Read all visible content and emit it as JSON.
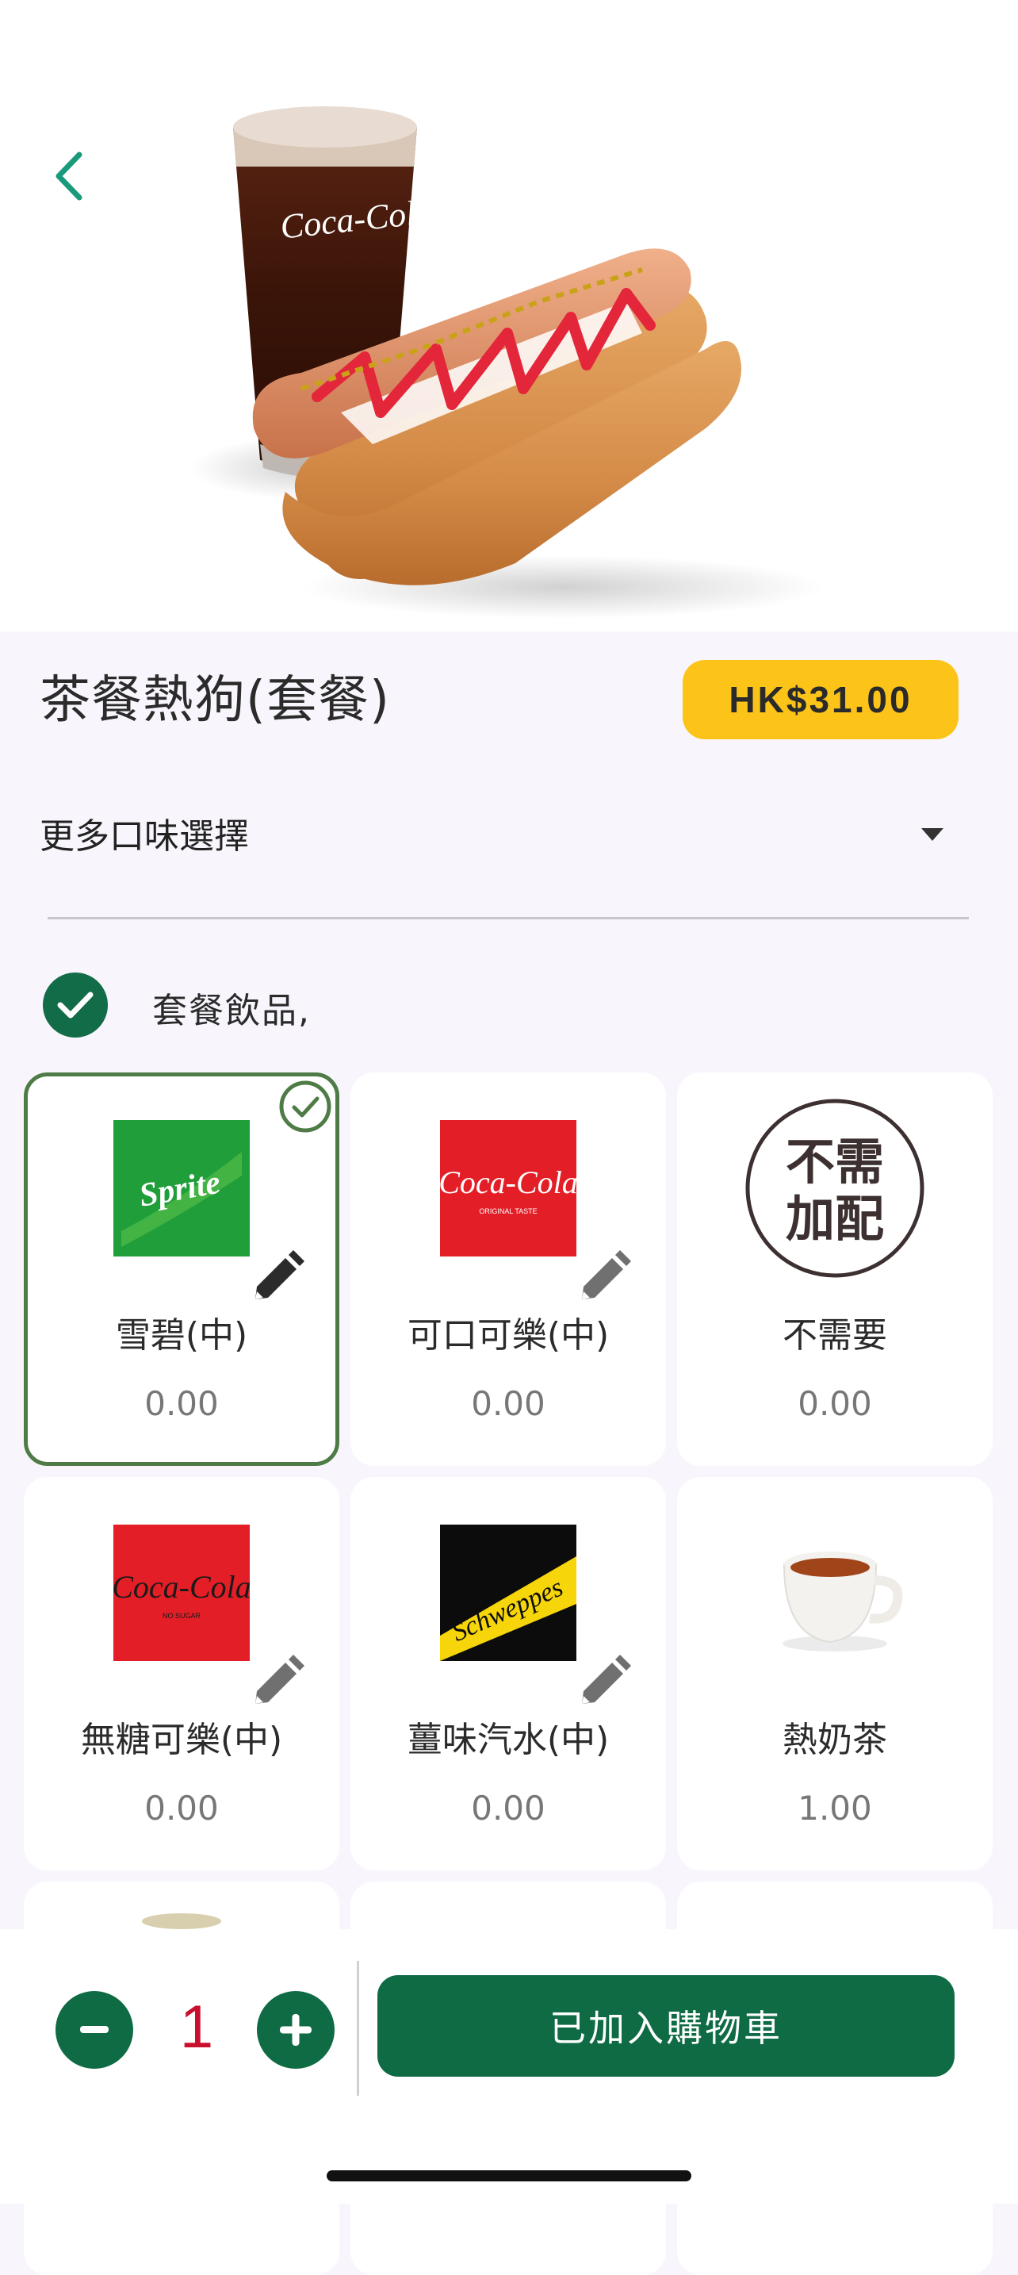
{
  "product": {
    "title": "茶餐熱狗(套餐)",
    "price": "HK$31.00"
  },
  "flavor_select": {
    "label": "更多口味選擇"
  },
  "drink_section": {
    "title": "套餐飲品,"
  },
  "drinks": [
    {
      "name": "雪碧(中)",
      "price": "0.00",
      "selected": true,
      "logo": "sprite-logo",
      "logo_text": "Sprite"
    },
    {
      "name": "可口可樂(中)",
      "price": "0.00",
      "selected": false,
      "logo": "coca-cola-logo",
      "logo_text": "Coca-Cola",
      "logo_subtext": "ORIGINAL TASTE"
    },
    {
      "name": "不需要",
      "price": "0.00",
      "selected": false,
      "logo": "no-addon-badge",
      "badge_line1": "不需",
      "badge_line2": "加配"
    },
    {
      "name": "無糖可樂(中)",
      "price": "0.00",
      "selected": false,
      "logo": "coca-cola-no-sugar-logo",
      "logo_text": "Coca-Cola",
      "logo_subtext": "NO SUGAR"
    },
    {
      "name": "薑味汽水(中)",
      "price": "0.00",
      "selected": false,
      "logo": "schweppes-logo",
      "logo_text": "Schweppes"
    },
    {
      "name": "熱奶茶",
      "price": "1.00",
      "selected": false,
      "logo": "milk-tea-cup"
    }
  ],
  "quantity": {
    "value": "1"
  },
  "cart_button": {
    "label": "已加入購物車"
  },
  "colors": {
    "primary_green": "#0f6b44",
    "price_badge": "#fcc419",
    "selected_border": "#4f7c46",
    "quantity_text": "#c8102e",
    "back_arrow": "#1a9a7a"
  },
  "hero": {
    "glass_logo_text": "Coca-Cola"
  }
}
